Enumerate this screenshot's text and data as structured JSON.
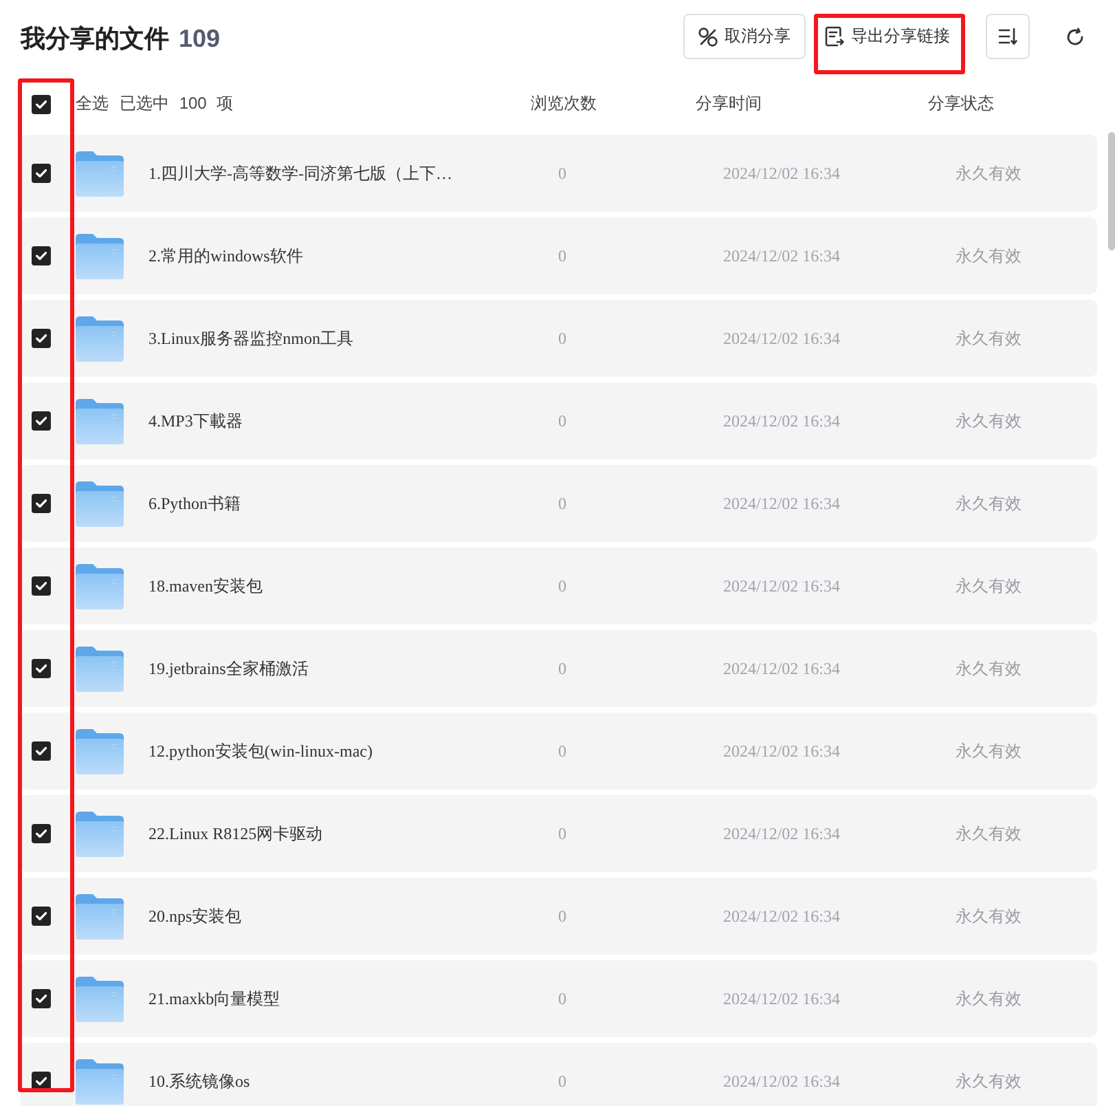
{
  "header": {
    "title": "我分享的文件",
    "count": "109"
  },
  "toolbar": [
    {
      "kind": "unshare",
      "label": "取消分享",
      "highlighted": false
    },
    {
      "kind": "export",
      "label": "导出分享链接",
      "highlighted": true
    },
    {
      "kind": "sort",
      "highlighted": false
    },
    {
      "kind": "refresh",
      "highlighted": false
    }
  ],
  "list_header": {
    "select_all": {
      "label": "全选",
      "checked": true
    },
    "selection": "已选中 100 项",
    "columns": [
      "浏览次数",
      "分享时间",
      "分享状态"
    ]
  },
  "checkbox_column_highlighted": true,
  "rows": [
    {
      "name": "1.四川大学-高等数学-同济第七版（上下…",
      "views": "0",
      "shared_at": "2024/12/02 16:34",
      "status": "永久有效",
      "checked": true
    },
    {
      "name": "2.常用的windows软件",
      "views": "0",
      "shared_at": "2024/12/02 16:34",
      "status": "永久有效",
      "checked": true
    },
    {
      "name": "3.Linux服务器监控nmon工具",
      "views": "0",
      "shared_at": "2024/12/02 16:34",
      "status": "永久有效",
      "checked": true
    },
    {
      "name": "4.MP3下載器",
      "views": "0",
      "shared_at": "2024/12/02 16:34",
      "status": "永久有效",
      "checked": true
    },
    {
      "name": "6.Python书籍",
      "views": "0",
      "shared_at": "2024/12/02 16:34",
      "status": "永久有效",
      "checked": true
    },
    {
      "name": "18.maven安装包",
      "views": "0",
      "shared_at": "2024/12/02 16:34",
      "status": "永久有效",
      "checked": true
    },
    {
      "name": "19.jetbrains全家桶激活",
      "views": "0",
      "shared_at": "2024/12/02 16:34",
      "status": "永久有效",
      "checked": true
    },
    {
      "name": "12.python安装包(win-linux-mac)",
      "views": "0",
      "shared_at": "2024/12/02 16:34",
      "status": "永久有效",
      "checked": true
    },
    {
      "name": "22.Linux R8125网卡驱动",
      "views": "0",
      "shared_at": "2024/12/02 16:34",
      "status": "永久有效",
      "checked": true
    },
    {
      "name": "20.nps安装包",
      "views": "0",
      "shared_at": "2024/12/02 16:34",
      "status": "永久有效",
      "checked": true
    },
    {
      "name": "21.maxkb向量模型",
      "views": "0",
      "shared_at": "2024/12/02 16:34",
      "status": "永久有效",
      "checked": true
    },
    {
      "name": "10.系统镜像os",
      "views": "0",
      "shared_at": "2024/12/02 16:34",
      "status": "永久有效",
      "checked": true
    }
  ]
}
